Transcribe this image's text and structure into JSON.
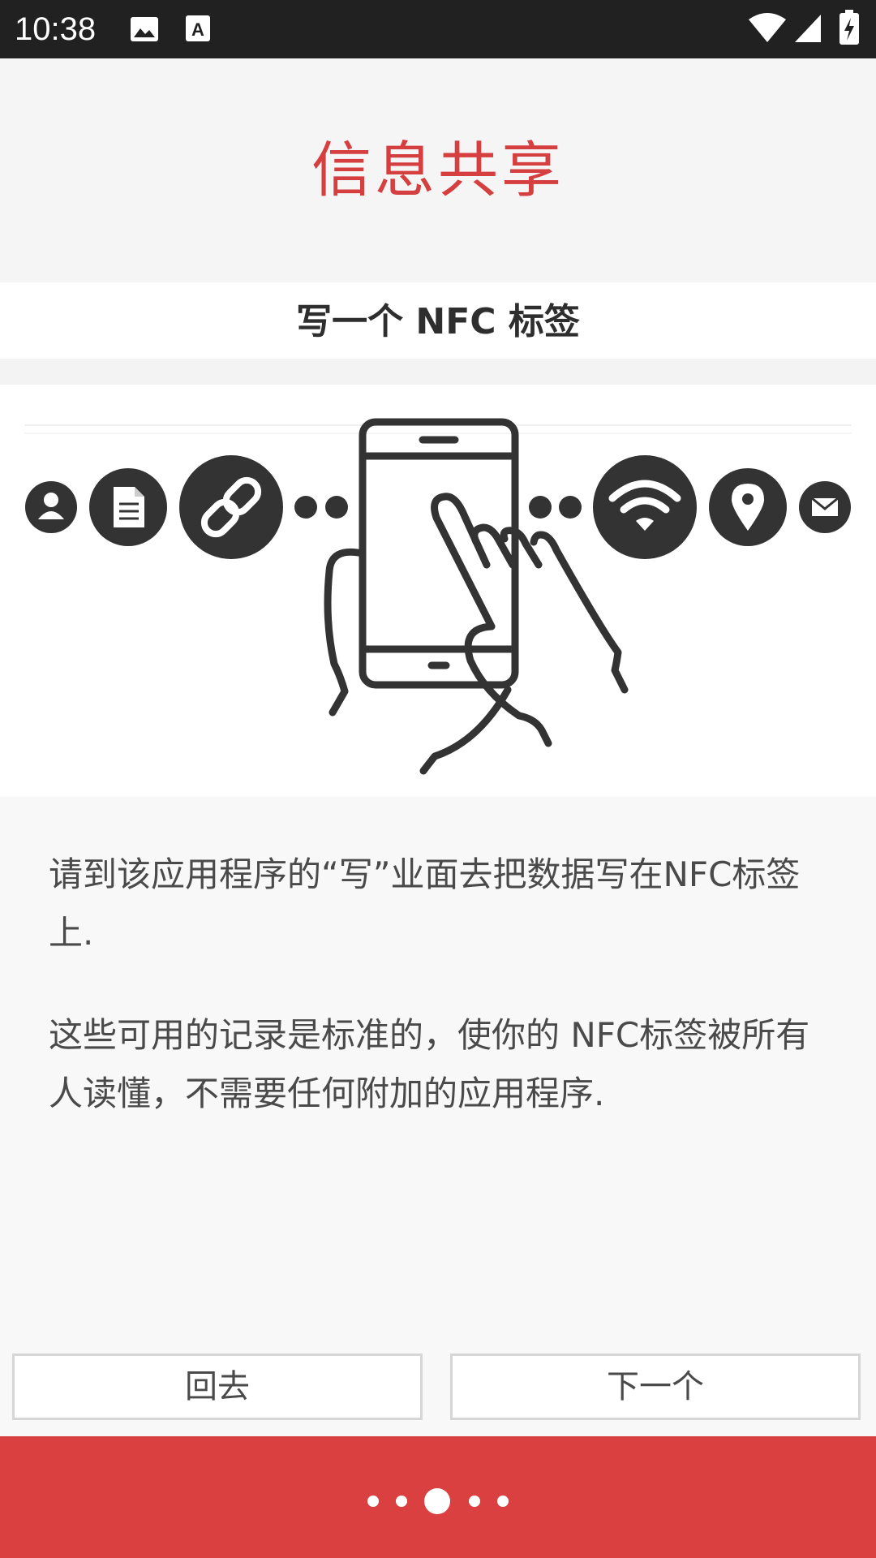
{
  "status_bar": {
    "time": "10:38",
    "icons": [
      "image-icon",
      "text-icon",
      "wifi-icon",
      "signal-icon",
      "battery-charging-icon"
    ]
  },
  "header": {
    "title": "信息共享"
  },
  "section": {
    "subtitle": "写一个 NFC 标签"
  },
  "illustration": {
    "icons": [
      "person-icon",
      "document-icon",
      "link-icon",
      "phone-hand-icon",
      "wifi-icon",
      "location-pin-icon",
      "mail-icon"
    ]
  },
  "content": {
    "paragraph_1": "请到该应用程序的“写”业面去把数据写在NFC标签上.",
    "paragraph_2": "这些可用的记录是标准的，使你的 NFC标签被所有人读懂，不需要任何附加的应用程序."
  },
  "buttons": {
    "back": "回去",
    "next": "下一个"
  },
  "pager": {
    "total": 5,
    "current": 3
  },
  "colors": {
    "accent": "#d63f3f",
    "bottom_bar": "#da4040",
    "status_bar": "#212121"
  }
}
